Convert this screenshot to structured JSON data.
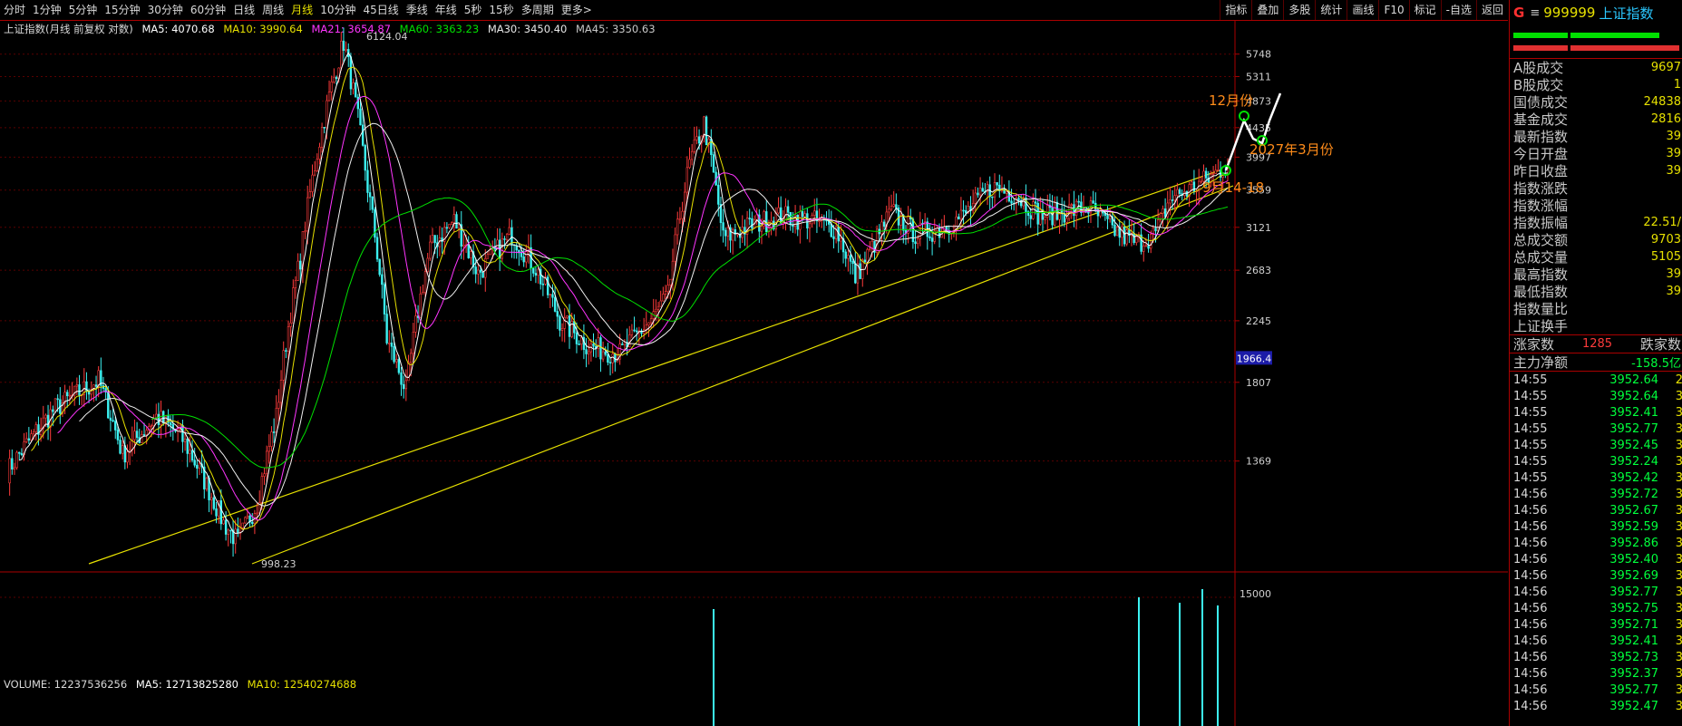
{
  "toolbar": {
    "periods": [
      "分时",
      "1分钟",
      "5分钟",
      "15分钟",
      "30分钟",
      "60分钟",
      "日线",
      "周线",
      "月线",
      "10分钟",
      "45日线",
      "季线",
      "年线",
      "5秒",
      "15秒",
      "多周期",
      "更多>"
    ],
    "active_period": "月线",
    "tools": [
      "指标",
      "叠加",
      "多股",
      "统计",
      "画线",
      "F10",
      "标记",
      "-自选",
      "返回"
    ]
  },
  "main_legend": {
    "title": "上证指数(月线 前复权 对数)",
    "ma5": "MA5: 4070.68",
    "ma10": "MA10: 3990.64",
    "ma21": "MA21: 3654.87",
    "ma60": "MA60: 3363.23",
    "ma30": "MA30: 3450.40",
    "ma45": "MA45: 3350.63"
  },
  "volume_legend": {
    "volume": "VOLUME: 12237536256",
    "ma5": "MA5: 12713825280",
    "ma10": "MA10: 12540274688"
  },
  "chart_data": {
    "type": "candlestick",
    "title": "上证指数(月线 前复权 对数)",
    "y_scale": "log",
    "y_ticks": [
      5748,
      5311,
      4873,
      4435,
      3997,
      3559,
      3121,
      2683,
      2245,
      1807,
      1369
    ],
    "volume_ticks": [
      15000
    ],
    "cursor_price": "1966.4",
    "high_label": "6124.04",
    "low_label": "998.23",
    "annotations": [
      "12月份",
      "2027年3月份",
      "9月14-18"
    ],
    "colors": {
      "up": "#ff3b3b",
      "down": "#3cf2f2",
      "ma5": "#ffffff",
      "ma10": "#e6e000",
      "ma21": "#ff35ff",
      "ma60": "#00e000",
      "ma30": "#f0f0f0",
      "ma45": "#c8c8c8",
      "trendline": "#e6e000",
      "annotation": "#ff8c1a"
    }
  },
  "panel": {
    "g": "G",
    "menu": "≡",
    "code": "999999",
    "name": "上证指数",
    "stats": [
      {
        "label": "A股成交",
        "value": "9697"
      },
      {
        "label": "B股成交",
        "value": "1"
      },
      {
        "label": "国债成交",
        "value": "24838"
      },
      {
        "label": "基金成交",
        "value": "2816"
      },
      {
        "label": "最新指数",
        "value": "39"
      },
      {
        "label": "今日开盘",
        "value": "39"
      },
      {
        "label": "昨日收盘",
        "value": "39"
      },
      {
        "label": "指数涨跌",
        "value": ""
      },
      {
        "label": "指数涨幅",
        "value": ""
      },
      {
        "label": "指数振幅",
        "value": "22.51/"
      },
      {
        "label": "总成交额",
        "value": "9703"
      },
      {
        "label": "总成交量",
        "value": "5105"
      },
      {
        "label": "最高指数",
        "value": "39"
      },
      {
        "label": "最低指数",
        "value": "39"
      },
      {
        "label": "指数量比",
        "value": ""
      },
      {
        "label": "上证换手",
        "value": ""
      }
    ],
    "rise_label": "涨家数",
    "rise_count": "1285",
    "fall_label": "跌家数",
    "main_flow_label": "主力净额",
    "main_flow_value": "-158.5亿",
    "ticks": [
      {
        "t": "14:55",
        "p": "3952.64",
        "v": "2"
      },
      {
        "t": "14:55",
        "p": "3952.64",
        "v": "3"
      },
      {
        "t": "14:55",
        "p": "3952.41",
        "v": "3"
      },
      {
        "t": "14:55",
        "p": "3952.77",
        "v": "3"
      },
      {
        "t": "14:55",
        "p": "3952.45",
        "v": "3"
      },
      {
        "t": "14:55",
        "p": "3952.24",
        "v": "3"
      },
      {
        "t": "14:55",
        "p": "3952.42",
        "v": "3"
      },
      {
        "t": "14:56",
        "p": "3952.72",
        "v": "3"
      },
      {
        "t": "14:56",
        "p": "3952.67",
        "v": "3"
      },
      {
        "t": "14:56",
        "p": "3952.59",
        "v": "3"
      },
      {
        "t": "14:56",
        "p": "3952.86",
        "v": "3"
      },
      {
        "t": "14:56",
        "p": "3952.40",
        "v": "3"
      },
      {
        "t": "14:56",
        "p": "3952.69",
        "v": "3"
      },
      {
        "t": "14:56",
        "p": "3952.77",
        "v": "3"
      },
      {
        "t": "14:56",
        "p": "3952.75",
        "v": "3"
      },
      {
        "t": "14:56",
        "p": "3952.71",
        "v": "3"
      },
      {
        "t": "14:56",
        "p": "3952.41",
        "v": "3"
      },
      {
        "t": "14:56",
        "p": "3952.73",
        "v": "3"
      },
      {
        "t": "14:56",
        "p": "3952.37",
        "v": "3"
      },
      {
        "t": "14:56",
        "p": "3952.77",
        "v": "3"
      },
      {
        "t": "14:56",
        "p": "3952.47",
        "v": "3"
      }
    ]
  }
}
